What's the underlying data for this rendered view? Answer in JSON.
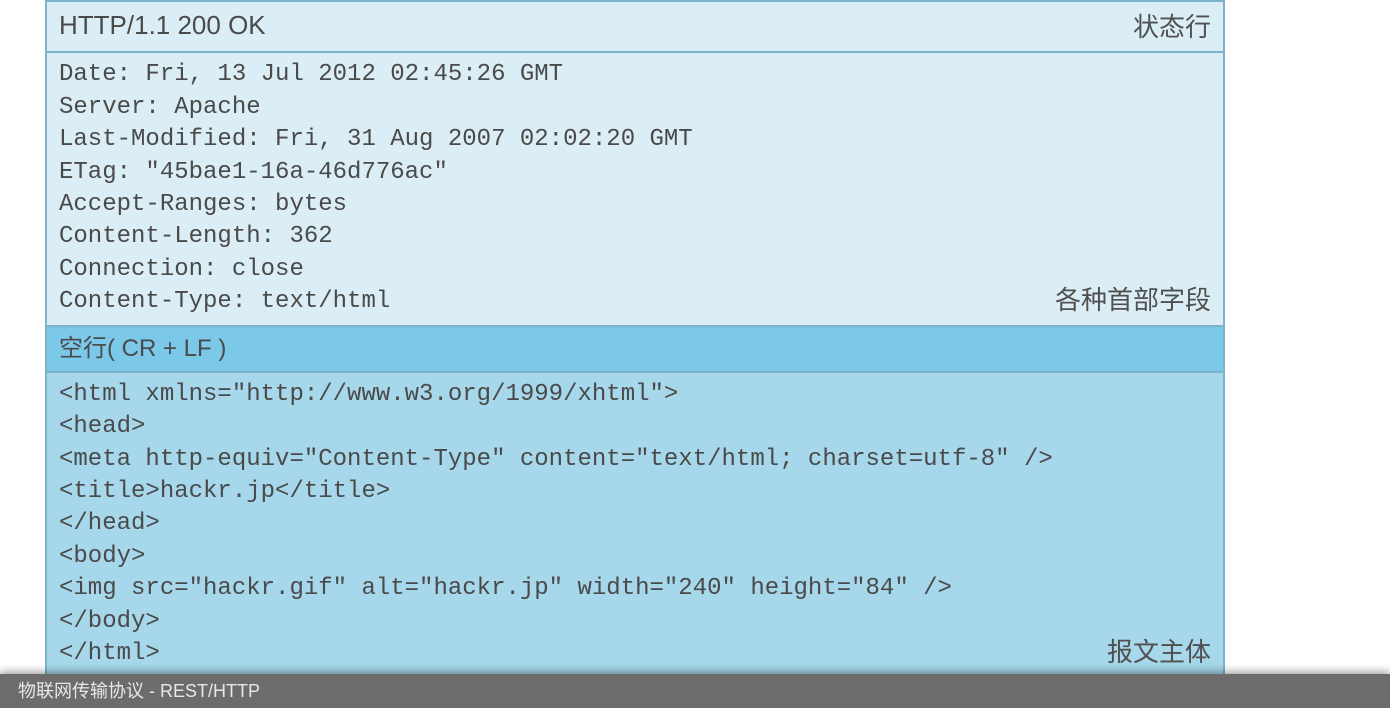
{
  "status_line": {
    "text": "HTTP/1.1 200 OK",
    "label": "状态行"
  },
  "headers": {
    "lines": [
      "Date: Fri, 13 Jul 2012 02:45:26 GMT",
      "Server: Apache",
      "Last-Modified: Fri, 31 Aug 2007 02:02:20 GMT",
      "ETag: \"45bae1-16a-46d776ac\"",
      "Accept-Ranges: bytes",
      "Content-Length: 362",
      "Connection: close",
      "Content-Type: text/html"
    ],
    "label": "各种首部字段"
  },
  "empty_line": {
    "text": "空行( CR + LF )"
  },
  "body": {
    "lines": [
      "<html xmlns=\"http://www.w3.org/1999/xhtml\">",
      "<head>",
      "<meta http-equiv=\"Content-Type\" content=\"text/html; charset=utf-8\" />",
      "<title>hackr.jp</title>",
      "</head>",
      "<body>",
      "<img src=\"hackr.gif\" alt=\"hackr.jp\" width=\"240\" height=\"84\" />",
      "</body>",
      "</html>"
    ],
    "label": "报文主体"
  },
  "footer": "物联网传输协议 - REST/HTTP"
}
